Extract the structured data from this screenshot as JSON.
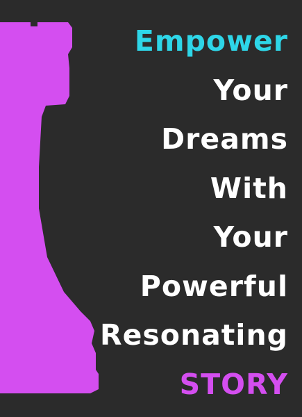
{
  "poster": {
    "lines": [
      "Empower",
      "Your",
      "Dreams",
      "With",
      "Your",
      "Powerful",
      "Resonating",
      "STORY"
    ]
  },
  "colors": {
    "background": "#2b2b2b",
    "text": "#ffffff",
    "accent_cyan": "#2ed6e8",
    "accent_purple": "#d44ef0",
    "rook": "#d44ef0"
  },
  "icons": {
    "rook": "chess-rook-icon"
  }
}
